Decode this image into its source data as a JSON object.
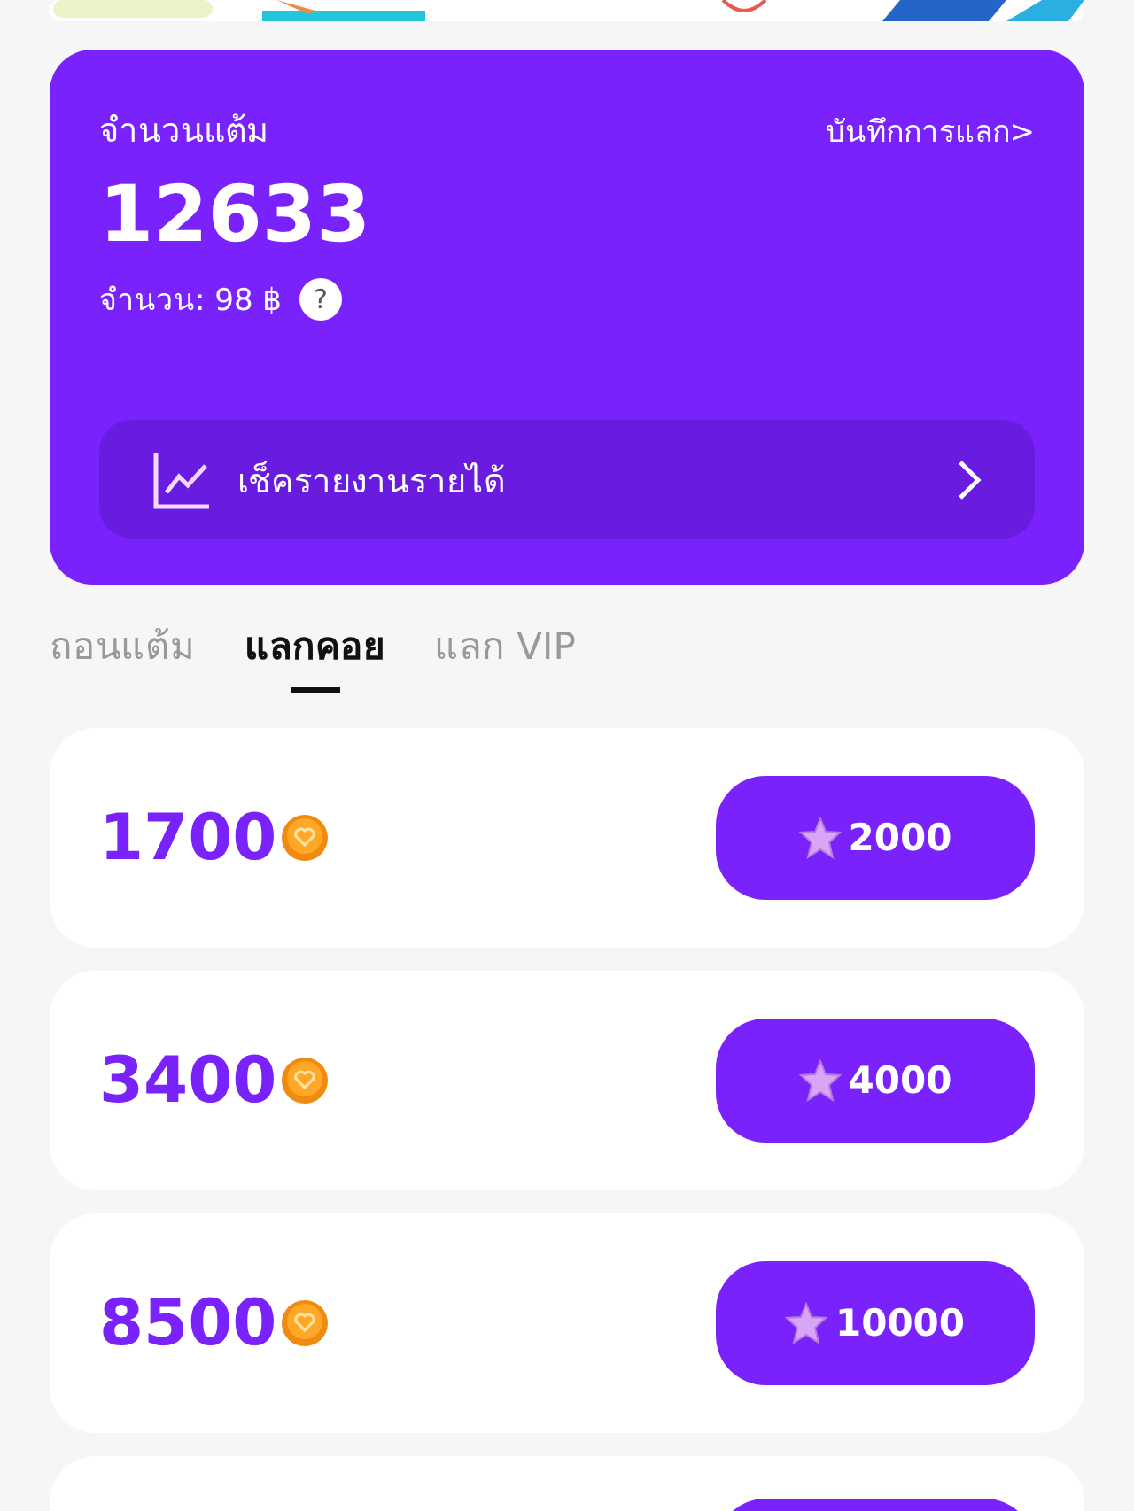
{
  "points_card": {
    "title": "จำนวนแต้ม",
    "history_link": "บันทึกการแลก>",
    "points": "12633",
    "amount": "จำนวน: 98 ฿",
    "help": "?",
    "report_button": "เช็ครายงานรายได้"
  },
  "tabs": [
    {
      "label": "ถอนแต้ม",
      "selected": false
    },
    {
      "label": "แลกคอย",
      "selected": true
    },
    {
      "label": "แลก VIP",
      "selected": false
    }
  ],
  "offers": [
    {
      "coins": "1700",
      "cost": "2000"
    },
    {
      "coins": "3400",
      "cost": "4000"
    },
    {
      "coins": "8500",
      "cost": "10000"
    }
  ]
}
